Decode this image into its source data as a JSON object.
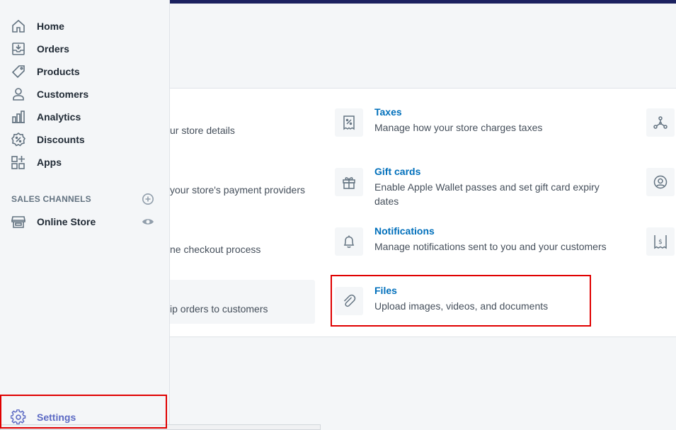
{
  "sidebar": {
    "items": [
      {
        "label": "Home",
        "icon": "home-icon"
      },
      {
        "label": "Orders",
        "icon": "orders-icon"
      },
      {
        "label": "Products",
        "icon": "tag-icon"
      },
      {
        "label": "Customers",
        "icon": "person-icon"
      },
      {
        "label": "Analytics",
        "icon": "bar-chart-icon"
      },
      {
        "label": "Discounts",
        "icon": "discount-icon"
      },
      {
        "label": "Apps",
        "icon": "apps-icon"
      }
    ],
    "sales_channels_heading": "SALES CHANNELS",
    "online_store_label": "Online Store",
    "settings_label": "Settings"
  },
  "settings": {
    "left_column_partials": [
      "ur store details",
      " your store's payment providers",
      "ne checkout process",
      "ip orders to customers"
    ],
    "tiles": [
      {
        "title": "Taxes",
        "description": "Manage how your store charges taxes",
        "icon": "receipt-percent-icon"
      },
      {
        "title": "Gift cards",
        "description": "Enable Apple Wallet passes and set gift card expiry dates",
        "icon": "gift-icon"
      },
      {
        "title": "Notifications",
        "description": "Manage notifications sent to you and your customers",
        "icon": "bell-icon"
      },
      {
        "title": "Files",
        "description": "Upload images, videos, and documents",
        "icon": "paperclip-icon"
      }
    ]
  },
  "colors": {
    "accent": "#5c6ac4",
    "link": "#006fbb",
    "highlight": "#e00000",
    "topbar": "#1c2260"
  }
}
